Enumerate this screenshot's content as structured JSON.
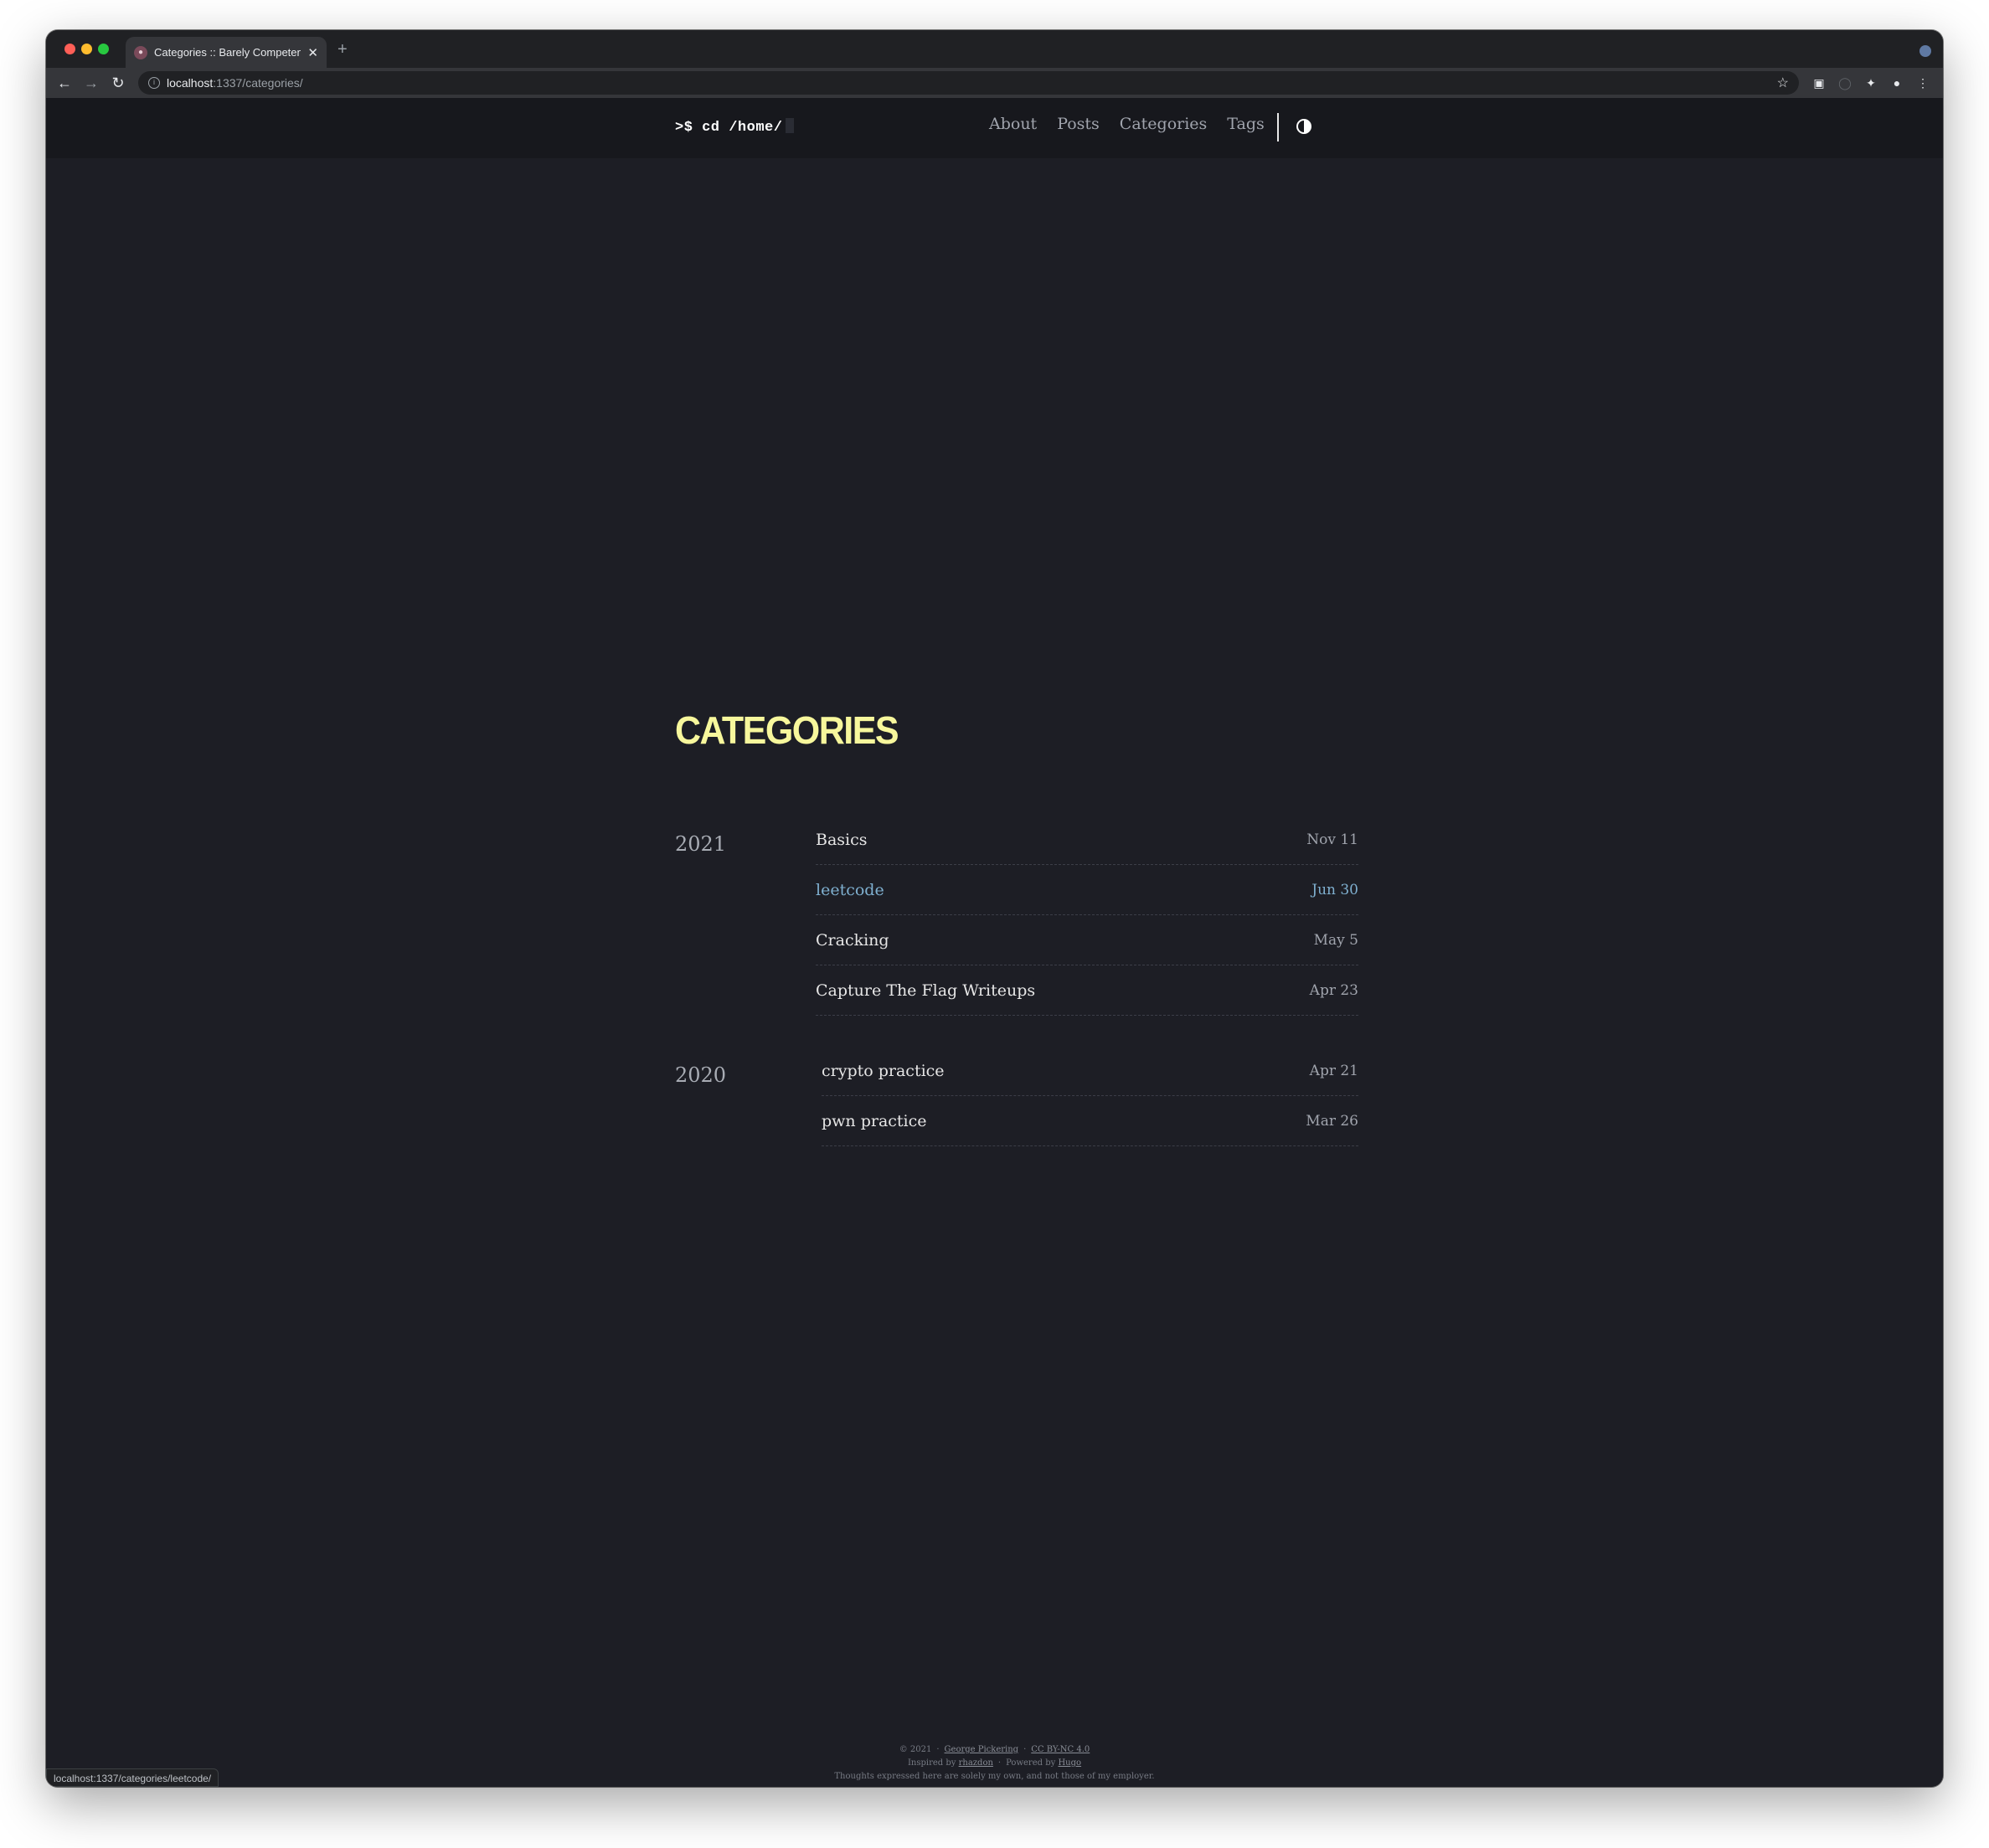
{
  "browser": {
    "tab_title": "Categories :: Barely Competent",
    "close_glyph": "✕",
    "new_tab_glyph": "+",
    "url_host": "localhost",
    "url_path": ":1337/categories/",
    "status_url": "localhost:1337/categories/leetcode/"
  },
  "site": {
    "logo": ">$ cd /home/",
    "menu": [
      "About",
      "Posts",
      "Categories",
      "Tags"
    ]
  },
  "page": {
    "title": "CATEGORIES",
    "groups": [
      {
        "year": "2021",
        "items": [
          {
            "name": "Basics",
            "date": "Nov 11"
          },
          {
            "name": "leetcode",
            "date": "Jun 30",
            "active": true
          },
          {
            "name": "Cracking",
            "date": "May 5"
          },
          {
            "name": "Capture The Flag Writeups",
            "date": "Apr 23"
          }
        ]
      },
      {
        "year": "2020",
        "items": [
          {
            "name": "crypto practice",
            "date": "Apr 21"
          },
          {
            "name": "pwn practice",
            "date": "Mar 26"
          }
        ]
      }
    ]
  },
  "footer": {
    "copyright": "© 2021",
    "author": "George Pickering",
    "license": "CC BY-NC 4.0",
    "inspired_prefix": "Inspired by",
    "inspired_link": "rhazdon",
    "powered_prefix": "Powered by",
    "powered_link": "Hugo",
    "disclaimer": "Thoughts expressed here are solely my own, and not those of my employer."
  },
  "colors": {
    "background": "#1d1e25",
    "header": "#17181d",
    "title_accent": "#f7f79c",
    "active_link": "#7fb0d0"
  }
}
